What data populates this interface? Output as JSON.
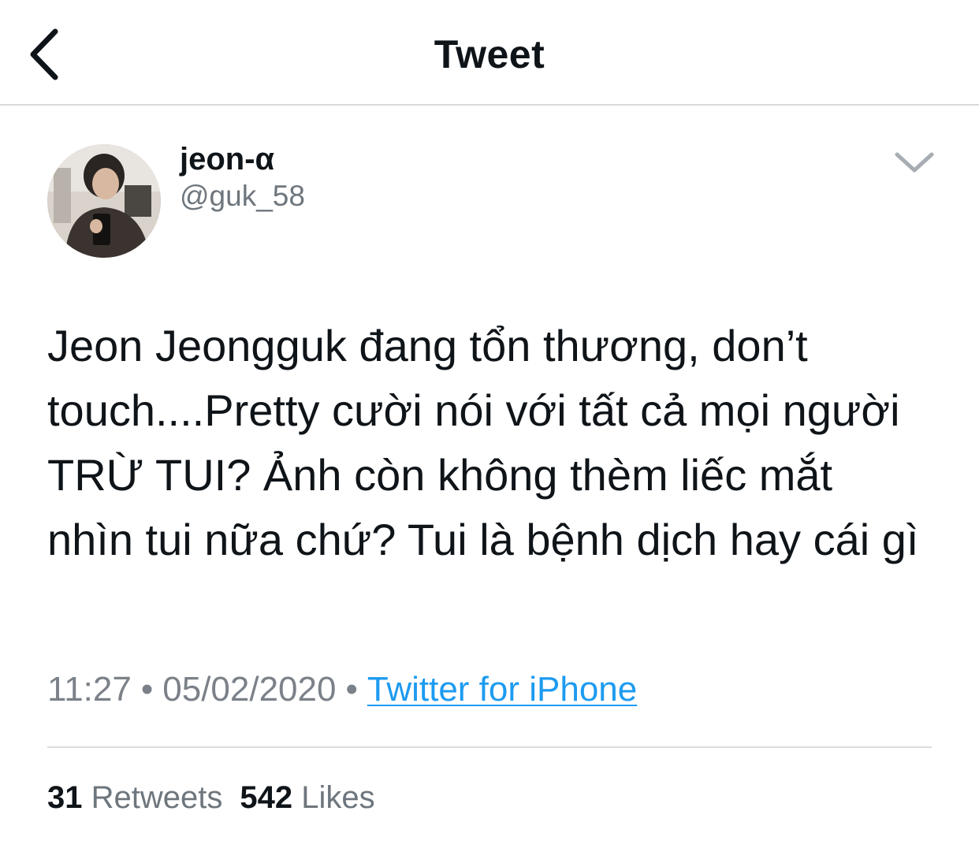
{
  "header": {
    "title": "Tweet",
    "back_icon": "chevron-left-icon"
  },
  "author": {
    "display_name": "jeon-α",
    "handle": "@guk_58"
  },
  "more_icon": "chevron-down-icon",
  "tweet": {
    "text": "Jeon Jeongguk đang tổn thương, don’t touch....Pretty cười nói với tất cả mọi người TRỪ TUI? Ảnh còn không thèm liếc mắt nhìn tui nữa chứ? Tui là bệnh dịch hay cái gì",
    "time": "11:27",
    "separator": "•",
    "date": "05/02/2020",
    "source": "Twitter for iPhone"
  },
  "stats": {
    "retweets_count": "31",
    "retweets_label": "Retweets",
    "likes_count": "542",
    "likes_label": "Likes"
  },
  "colors": {
    "link": "#1d9bf0",
    "secondary_text": "#6e767d",
    "divider": "#dcdcdc"
  }
}
